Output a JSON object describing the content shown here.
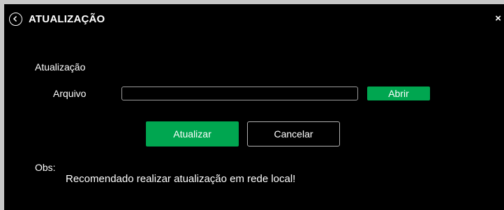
{
  "header": {
    "title": "ATUALIZAÇÃO",
    "back_icon": "chevron-left-circle-icon",
    "close_label": "×"
  },
  "form": {
    "section_label": "Atualização",
    "file_label": "Arquivo",
    "file_value": "",
    "open_label": "Abrir"
  },
  "actions": {
    "update_label": "Atualizar",
    "cancel_label": "Cancelar"
  },
  "notes": {
    "obs_label": "Obs:",
    "obs_text": "Recomendado realizar atualização em rede local!"
  },
  "colors": {
    "background": "#000000",
    "accent": "#00a650",
    "text": "#ffffff",
    "frame": "#c8c8c8"
  }
}
